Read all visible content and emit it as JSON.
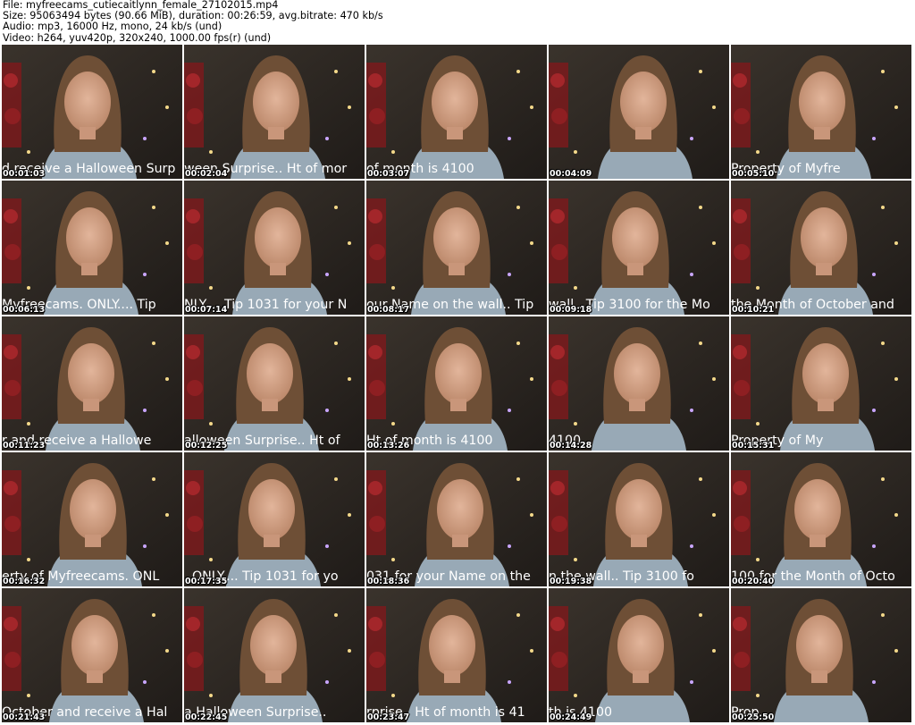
{
  "header": {
    "file": "File: myfreecams_cutiecaitlynn_female_27102015.mp4",
    "size": "Size: 95063494 bytes (90.66 MiB), duration: 00:26:59, avg.bitrate: 470 kb/s",
    "audio": "Audio: mp3, 16000 Hz, mono, 24 kb/s (und)",
    "video": "Video: h264, yuv420p, 320x240, 1000.00 fps(r) (und)"
  },
  "thumbnails": [
    {
      "timestamp": "00:01:03",
      "caption": "d receive a Halloween Surp"
    },
    {
      "timestamp": "00:02:04",
      "caption": "ween Surprise..  Ht of mor"
    },
    {
      "timestamp": "00:03:07",
      "caption": "of month is 4100"
    },
    {
      "timestamp": "00:04:09",
      "caption": ""
    },
    {
      "timestamp": "00:05:10",
      "caption": "       Property of Myfre"
    },
    {
      "timestamp": "00:06:13",
      "caption": " Myfreecams. ONLY....  Tip"
    },
    {
      "timestamp": "00:07:14",
      "caption": "NLY....  Tip 1031 for your N"
    },
    {
      "timestamp": "00:08:17",
      "caption": "our Name on the wall..  Tip"
    },
    {
      "timestamp": "00:09:18",
      "caption": "wall..  Tip 3100 for the Mo"
    },
    {
      "timestamp": "00:10:21",
      "caption": "the Month of October and"
    },
    {
      "timestamp": "00:11:23",
      "caption": "r and receive a Hallowe"
    },
    {
      "timestamp": "00:12:25",
      "caption": "alloween Surprise..  Ht of"
    },
    {
      "timestamp": "00:13:26",
      "caption": "Ht of month is 4100"
    },
    {
      "timestamp": "00:14:28",
      "caption": "4100"
    },
    {
      "timestamp": "00:15:31",
      "caption": "       Property of My"
    },
    {
      "timestamp": "00:16:32",
      "caption": "erty of Myfreecams. ONL"
    },
    {
      "timestamp": "00:17:35",
      "caption": ". ONLY....  Tip 1031 for yo"
    },
    {
      "timestamp": "00:18:36",
      "caption": "031 for your Name on the"
    },
    {
      "timestamp": "00:19:38",
      "caption": "n the wall..  Tip 3100 fo"
    },
    {
      "timestamp": "00:20:40",
      "caption": "100 for the Month of Octo"
    },
    {
      "timestamp": "00:21:43",
      "caption": "October and receive a Hal"
    },
    {
      "timestamp": "00:22:45",
      "caption": "a Halloween Surprise.."
    },
    {
      "timestamp": "00:23:47",
      "caption": "rprise..  Ht of month is 41"
    },
    {
      "timestamp": "00:24:49",
      "caption": "th is 4100"
    },
    {
      "timestamp": "00:25:50",
      "caption": "                     Prop"
    }
  ]
}
